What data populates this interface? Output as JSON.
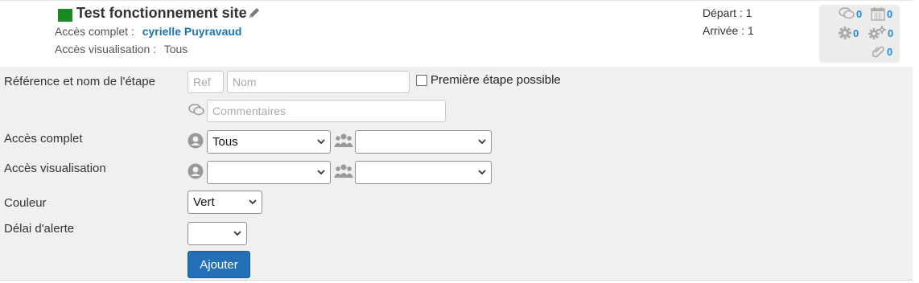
{
  "colors": {
    "step_color": "#1a8b22",
    "link": "#1b75bb",
    "count": "#1b8fd8",
    "button": "#2370b8"
  },
  "step": {
    "title": "Test fonctionnement site",
    "full_access_label": "Accès complet :",
    "full_access_user": "cyrielle Puyravaud",
    "view_access_label": "Accès visualisation :",
    "view_access_value": "Tous",
    "depart": "Départ : 1",
    "arrivee": "Arrivée : 1",
    "stats": {
      "comments": "0",
      "calendar": "0",
      "gear": "0",
      "gears": "0",
      "attachments": "0"
    }
  },
  "form": {
    "ref_label": "Référence et nom de l'étape",
    "ref_placeholder": "Ref",
    "name_placeholder": "Nom",
    "first_step_label": "Première étape possible",
    "comments_placeholder": "Commentaires",
    "full_access_label": "Accès complet",
    "full_access_user_selected": "Tous",
    "full_access_group_selected": "",
    "view_access_label": "Accès visualisation",
    "view_access_user_selected": "",
    "view_access_group_selected": "",
    "color_label": "Couleur",
    "color_selected": "Vert",
    "delay_label": "Délai d'alerte",
    "delay_selected": "",
    "submit_label": "Ajouter"
  }
}
